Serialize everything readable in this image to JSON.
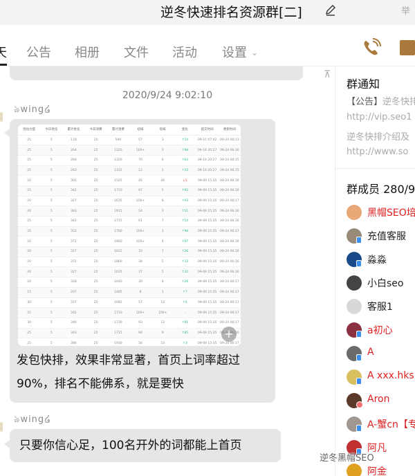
{
  "window": {
    "title": "逆冬快速排名资源群[二]",
    "report_label": "举"
  },
  "tabs": [
    {
      "label": "天",
      "active": true
    },
    {
      "label": "公告"
    },
    {
      "label": "相册"
    },
    {
      "label": "文件"
    },
    {
      "label": "活动"
    },
    {
      "label": "设置"
    }
  ],
  "accent_color": "#a97a3c",
  "chat": {
    "timestamp": "2020/9/24 9:02:10",
    "messages": [
      {
        "sender": "wing",
        "image": {
          "headers": [
            "优化力度",
            "今日优化",
            "累计优化",
            "今日消费",
            "累计消费",
            "初排",
            "现排",
            "变化",
            "提交时间",
            "更新时间"
          ],
          "rows": [
            [
              "25",
              "5",
              "118",
              "25",
              "590",
              "57",
              "3",
              "↑54",
              "09-15 07:42",
              "09-24 06:13"
            ],
            [
              "25",
              "5",
              "264",
              "25",
              "1320",
              "100+",
              "3",
              "↑98",
              "09-10 20:27",
              "09-24 06:16"
            ],
            [
              "25",
              "5",
              "264",
              "25",
              "1320",
              "70",
              "6",
              "↑64",
              "09-10 20:27",
              "09-24 06:15"
            ],
            [
              "25",
              "5",
              "263",
              "25",
              "1315",
              "12",
              "2",
              "↑10",
              "09-10 20:27",
              "09-24 06:15"
            ],
            [
              "20",
              "5",
              "301",
              "25",
              "1505",
              "45",
              "46",
              "↓1",
              "09-09 15:35",
              "09-24 06:16"
            ],
            [
              "25",
              "5",
              "342",
              "25",
              "1710",
              "97",
              "5",
              "↑92",
              "09-09 15:35",
              "09-24 06:16"
            ],
            [
              "20",
              "5",
              "327",
              "25",
              "1635",
              "100+",
              "8",
              "↑93",
              "09-09 15:35",
              "09-24 06:17"
            ],
            [
              "20",
              "5",
              "383",
              "25",
              "1915",
              "54",
              "3",
              "↑51",
              "09-09 15:35",
              "09-24 06:16"
            ],
            [
              "25",
              "5",
              "343",
              "25",
              "1715",
              "61",
              "7",
              "↑54",
              "09-09 15:35",
              "09-24 06:16"
            ],
            [
              "35",
              "5",
              "352",
              "25",
              "1760",
              "100+",
              "3",
              "↑98",
              "09-09 15:35",
              "09-24 06:17"
            ],
            [
              "20",
              "5",
              "372",
              "25",
              "1860",
              "100+",
              "4",
              "↑97",
              "09-09 15:35",
              "09-24 06:16"
            ],
            [
              "20",
              "5",
              "327",
              "25",
              "1635",
              "33",
              "7",
              "↑26",
              "09-09 15:35",
              "09-24 06:16"
            ],
            [
              "20",
              "5",
              "372",
              "25",
              "1860",
              "38",
              "5",
              "↑33",
              "09-09 15:35",
              "09-24 06:16"
            ],
            [
              "20",
              "5",
              "327",
              "25",
              "1635",
              "37",
              "5",
              "↑32",
              "09-09 15:35",
              "09-24 06:16"
            ],
            [
              "20",
              "5",
              "328",
              "25",
              "1640",
              "30",
              "4",
              "↑26",
              "09-09 15:35",
              "09-24 06:17"
            ],
            [
              "15",
              "5",
              "297",
              "25",
              "1485",
              "8",
              "1",
              "↑7",
              "09-09 15:35",
              "09-24 06:17"
            ],
            [
              "30",
              "5",
              "337",
              "25",
              "1685",
              "57",
              "53",
              "↑4",
              "09-09 15:35",
              "09-24 06:17"
            ],
            [
              "25",
              "5",
              "342",
              "25",
              "1710",
              "100+",
              "100+",
              "-",
              "09-09 15:35",
              "09-24 06:17"
            ],
            [
              "30",
              "5",
              "346",
              "25",
              "1730",
              "93",
              "12",
              "↑81",
              "09-09 15:35",
              "09-24 06:17"
            ],
            [
              "25",
              "5",
              "343",
              "25",
              "1715",
              "94",
              "9",
              "↑85",
              "09-09 15:35",
              "09-24 06:16"
            ],
            [
              "25",
              "5",
              "386",
              "25",
              "1930",
              "56",
              "53",
              "↑3",
              "09-09 15:35",
              "09-24 06:17"
            ]
          ]
        },
        "text": "发包快排，效果非常显著，首页上词率超过90%，排名不能佛系，就是要快"
      },
      {
        "sender": "wing",
        "text": "只要你信心足，100名开外的词都能上首页"
      }
    ]
  },
  "sidebar": {
    "notice_title": "群通知",
    "notice_tag": "【公告】",
    "notice_lines": [
      "逆冬快排",
      "http://vip.seo1",
      "逆冬快排介绍及",
      "http://www.so"
    ],
    "members_title": "群成员 280/9",
    "members": [
      {
        "name": "黑帽SEO培",
        "red": true,
        "avatar_color": "#e8a878",
        "badge": "none"
      },
      {
        "name": "充值客服",
        "red": false,
        "avatar_color": "#9a8a7a",
        "badge": "mobile"
      },
      {
        "name": "淼淼",
        "red": false,
        "avatar_color": "#1a4a8a",
        "badge": "mobile"
      },
      {
        "name": "小白seo",
        "red": false,
        "avatar_color": "#444444",
        "badge": "none"
      },
      {
        "name": "客服1",
        "red": false,
        "avatar_color": "#d8d8d8",
        "badge": "none"
      },
      {
        "name": "a初心",
        "red": true,
        "avatar_color": "#8a3040",
        "badge": "mobile"
      },
      {
        "name": "A",
        "red": true,
        "avatar_color": "#6a6a6a",
        "badge": "mobile"
      },
      {
        "name": "A  xxx.hks",
        "red": true,
        "avatar_color": "#d8c060",
        "badge": "mobile"
      },
      {
        "name": "Aron",
        "red": true,
        "avatar_color": "#5a3a2a",
        "badge": "red"
      },
      {
        "name": "A-蟹cn【专",
        "red": true,
        "avatar_color": "#a09890",
        "badge": "mobile"
      },
      {
        "name": "阿凡",
        "red": true,
        "avatar_color": "#c03030",
        "badge": "mobile"
      },
      {
        "name": "阿金",
        "red": true,
        "avatar_color": "#e0a020",
        "badge": "none"
      }
    ]
  },
  "watermark": "逆冬黑帽SEO"
}
